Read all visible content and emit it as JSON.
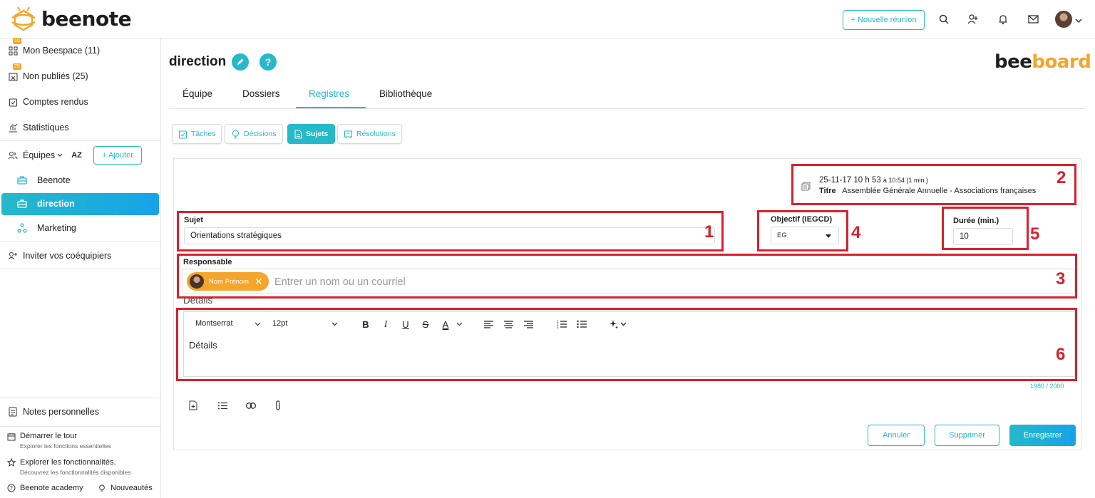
{
  "app": {
    "logo_text": "beenote",
    "brand_right": {
      "part1": "bee",
      "part2": "board"
    }
  },
  "header": {
    "new_meeting": "+ Nouvelle réunion"
  },
  "sidebar": {
    "items": [
      {
        "label": "Mon Beespace (11)",
        "badge": "10"
      },
      {
        "label": "Non publiés (25)",
        "badge": "25"
      },
      {
        "label": "Comptes rendus"
      },
      {
        "label": "Statistiques"
      }
    ],
    "teams_label": "Équipes",
    "sort_label": "AZ",
    "add_label": "+ Ajouter",
    "teams": [
      "Beenote",
      "direction",
      "Marketing"
    ],
    "invite": "Inviter vos coéquipiers",
    "notes": "Notes personnelles",
    "tour": {
      "title": "Démarrer le tour",
      "sub": "Explorer les fonctions essentielles"
    },
    "explore": {
      "title": "Explorer les fonctionnalités.",
      "sub": "Découvrez les fonctionnalités disponibles"
    },
    "academy": "Beenote academy",
    "news": "Nouveautés"
  },
  "page": {
    "title": "direction",
    "help": "?",
    "tabs": [
      "Équipe",
      "Dossiers",
      "Registres",
      "Bibliothèque"
    ],
    "chips": [
      "Tâches",
      "Décisions",
      "Sujets",
      "Résolutions"
    ]
  },
  "form": {
    "meta_date": "25-11-17 10 h 53",
    "meta_range": "à 10:54 (1 min.)",
    "meta_title_label": "Titre",
    "meta_title": "Assemblée Générale Annuelle - Associations françaises",
    "subject_label": "Sujet",
    "subject_value": "Orientations stratégiques",
    "objective_label": "Objectif  (IEGCD)",
    "objective_value": "EG",
    "duration_label": "Durée (min.)",
    "duration_value": "10",
    "responsible_label": "Responsable",
    "responsible_tag": "Nom Prénom",
    "responsible_placeholder": "Entrer un nom ou un courriel",
    "details_label": "Détails",
    "font_name": "Montserrat",
    "font_size": "12pt",
    "details_text": "Détails",
    "counter": "1980 / 2000",
    "cancel": "Annuler",
    "delete": "Supprimer",
    "save": "Enregistrer"
  },
  "annotations": [
    "1",
    "2",
    "3",
    "4",
    "5",
    "6"
  ],
  "colors": {
    "accent": "#25b9c9",
    "brand": "#f4a52b",
    "annotation": "#d7212e"
  }
}
